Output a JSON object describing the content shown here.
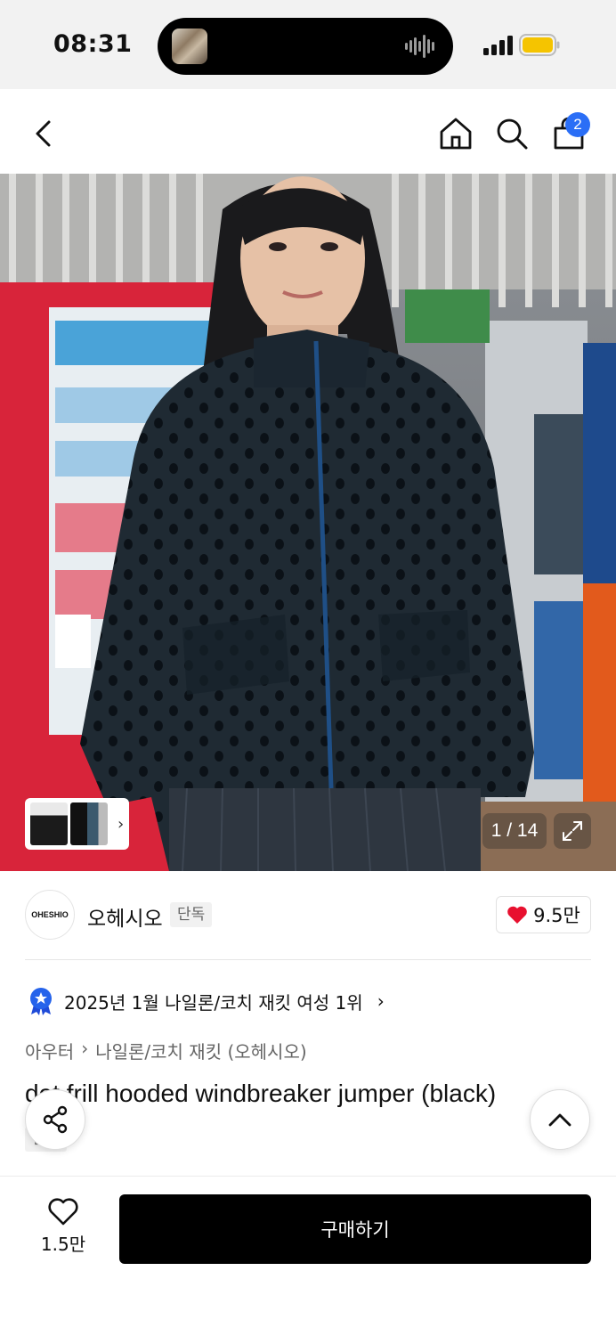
{
  "status_bar": {
    "time": "08:31",
    "battery_color": "#f5c400",
    "icons": [
      "media-thumbnail-icon",
      "audio-wave-icon",
      "cellular-signal-icon",
      "battery-icon"
    ]
  },
  "nav": {
    "icons": [
      "back-icon",
      "home-icon",
      "search-icon",
      "shopping-bag-icon"
    ],
    "cart_count": "2",
    "badge_color": "#2a6ef6"
  },
  "gallery": {
    "counter": "1 / 14",
    "icons": [
      "expand-icon",
      "chevron-right-icon"
    ]
  },
  "brand": {
    "logo_text": "OHESHIO",
    "name": "오헤시오",
    "tag": "단독",
    "likes": "9.5만",
    "heart_color": "#e8102f"
  },
  "ranking": {
    "text": "2025년 1월 나일론/코치 재킷 여성 1위",
    "arrow": "›"
  },
  "breadcrumb": {
    "items": [
      "아우터",
      "나일론/코치 재킷 (오헤시오)"
    ],
    "separator": "›"
  },
  "product": {
    "title": "dot frill hooded windbreaker jumper (black)",
    "tag": "단독"
  },
  "bottom": {
    "wish_count": "1.5만",
    "buy_label": "구매하기"
  }
}
